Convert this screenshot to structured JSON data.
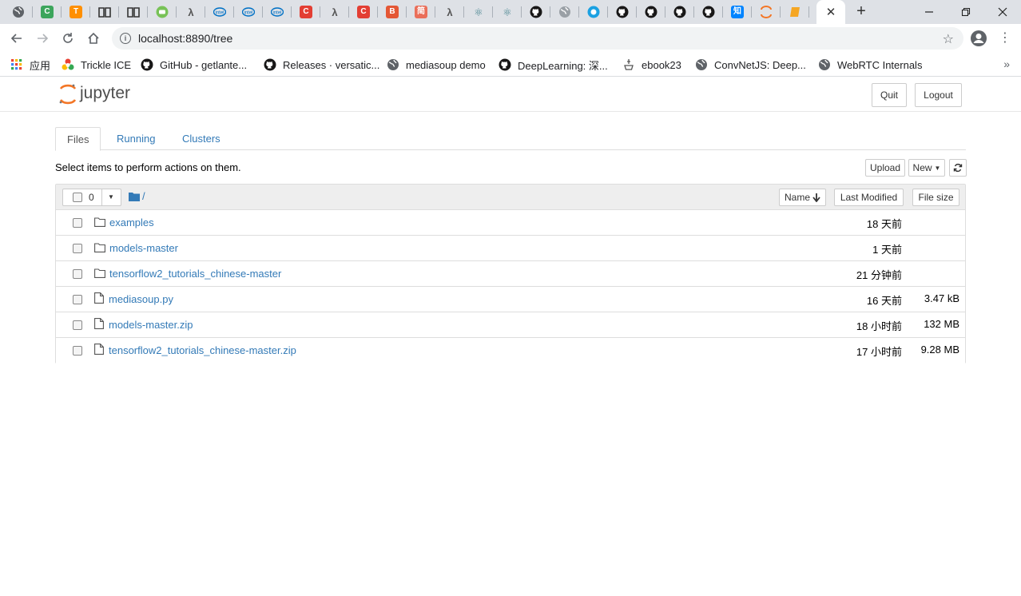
{
  "browser": {
    "tabs": [
      {
        "icon": "globe-icon",
        "color": "#5f6368",
        "glyph": ""
      },
      {
        "icon": "c-green-icon",
        "color": "#3ca55c",
        "glyph": "C"
      },
      {
        "icon": "tensorflow-icon",
        "color": "#ff8f00",
        "glyph": "T"
      },
      {
        "icon": "book-icon",
        "color": "#333333",
        "glyph": ""
      },
      {
        "icon": "book-icon",
        "color": "#333333",
        "glyph": ""
      },
      {
        "icon": "android-icon",
        "color": "#78c257",
        "glyph": ""
      },
      {
        "icon": "lambda-icon",
        "color": "#555555",
        "glyph": "λ"
      },
      {
        "icon": "intel-icon",
        "color": "#0071c5",
        "glyph": "i"
      },
      {
        "icon": "intel-icon",
        "color": "#0071c5",
        "glyph": "i"
      },
      {
        "icon": "intel-icon",
        "color": "#0071c5",
        "glyph": "i"
      },
      {
        "icon": "csdn-icon",
        "color": "#e33e33",
        "glyph": "C"
      },
      {
        "icon": "lambda-icon",
        "color": "#555555",
        "glyph": "λ"
      },
      {
        "icon": "csdn-icon",
        "color": "#e33e33",
        "glyph": "C"
      },
      {
        "icon": "b-icon",
        "color": "#e45735",
        "glyph": "B"
      },
      {
        "icon": "jianshu-icon",
        "color": "#ea6f5a",
        "glyph": "简"
      },
      {
        "icon": "lambda-icon",
        "color": "#555555",
        "glyph": "λ"
      },
      {
        "icon": "electron-icon",
        "color": "#47848f",
        "glyph": "⚛"
      },
      {
        "icon": "electron-icon",
        "color": "#47848f",
        "glyph": "⚛"
      },
      {
        "icon": "github-icon",
        "color": "#181717",
        "glyph": ""
      },
      {
        "icon": "globe-icon",
        "color": "#9aa0a6",
        "glyph": ""
      },
      {
        "icon": "circle-blue-icon",
        "color": "#1ba1e2",
        "glyph": ""
      },
      {
        "icon": "github-icon",
        "color": "#181717",
        "glyph": ""
      },
      {
        "icon": "github-icon",
        "color": "#181717",
        "glyph": ""
      },
      {
        "icon": "github-icon",
        "color": "#181717",
        "glyph": ""
      },
      {
        "icon": "github-icon",
        "color": "#181717",
        "glyph": ""
      },
      {
        "icon": "zhihu-icon",
        "color": "#0084ff",
        "glyph": "知"
      },
      {
        "icon": "jupyter-icon",
        "color": "#f37626",
        "glyph": ""
      },
      {
        "icon": "notebook-icon",
        "color": "#f5a623",
        "glyph": ""
      }
    ],
    "active_tab_close": "✕",
    "new_tab": "+",
    "url": "localhost:8890/tree",
    "bookmarks": [
      {
        "label": "应用",
        "icon": "apps-grid-icon"
      },
      {
        "label": "Trickle ICE",
        "icon": "webrtc-icon"
      },
      {
        "label": "GitHub - getlante...",
        "icon": "github-icon"
      },
      {
        "label": "Releases · versatic...",
        "icon": "github-icon"
      },
      {
        "label": "mediasoup demo",
        "icon": "globe-icon"
      },
      {
        "label": "DeepLearning: 深...",
        "icon": "github-icon"
      },
      {
        "label": "ebook23",
        "icon": "ebook-icon"
      },
      {
        "label": "ConvNetJS: Deep...",
        "icon": "globe-icon"
      },
      {
        "label": "WebRTC Internals",
        "icon": "globe-icon"
      }
    ],
    "bookmarks_more": "»"
  },
  "jupyter": {
    "logo_text": "jupyter",
    "quit_label": "Quit",
    "logout_label": "Logout",
    "tabs": [
      {
        "label": "Files",
        "active": true
      },
      {
        "label": "Running",
        "active": false
      },
      {
        "label": "Clusters",
        "active": false
      }
    ],
    "hint": "Select items to perform actions on them.",
    "upload_label": "Upload",
    "new_label": "New",
    "selected_count": "0",
    "breadcrumb": "/",
    "columns": {
      "name": "Name",
      "last_modified": "Last Modified",
      "file_size": "File size"
    },
    "items": [
      {
        "type": "folder",
        "name": "examples",
        "modified": "18 天前",
        "size": ""
      },
      {
        "type": "folder",
        "name": "models-master",
        "modified": "1 天前",
        "size": ""
      },
      {
        "type": "folder",
        "name": "tensorflow2_tutorials_chinese-master",
        "modified": "21 分钟前",
        "size": ""
      },
      {
        "type": "file",
        "name": "mediasoup.py",
        "modified": "16 天前",
        "size": "3.47 kB"
      },
      {
        "type": "file",
        "name": "models-master.zip",
        "modified": "18 小时前",
        "size": "132 MB"
      },
      {
        "type": "file",
        "name": "tensorflow2_tutorials_chinese-master.zip",
        "modified": "17 小时前",
        "size": "9.28 MB"
      }
    ],
    "link_color": "#337ab7",
    "brand_color": "#f37626"
  }
}
